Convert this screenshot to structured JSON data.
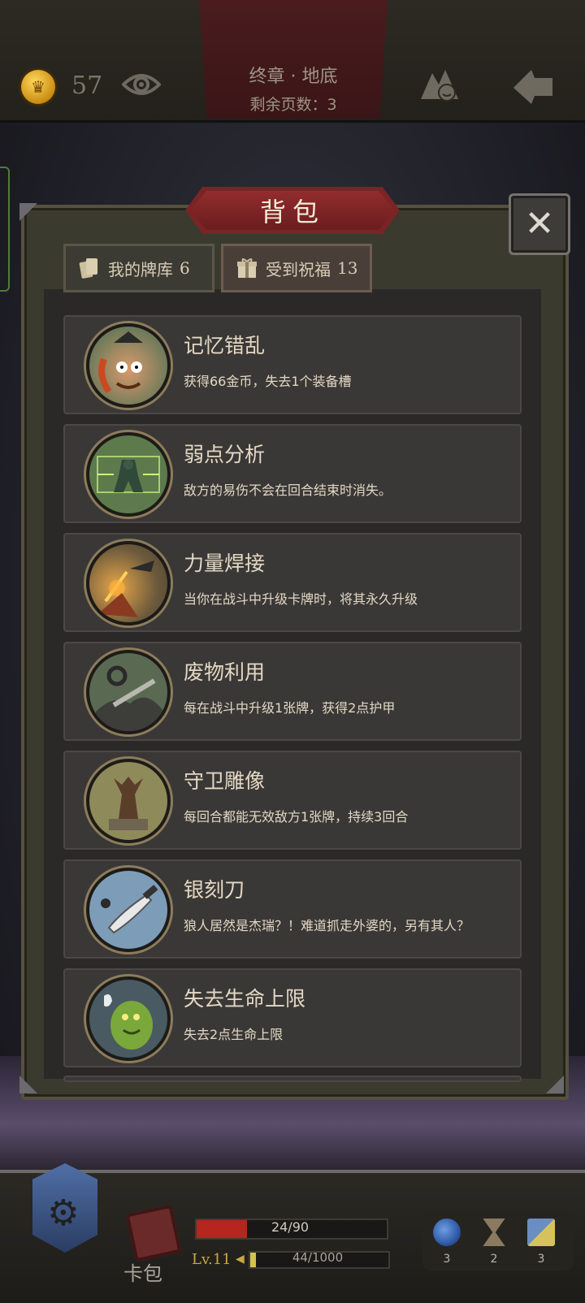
{
  "header": {
    "gold": "57",
    "chapter": "终章 · 地底",
    "pages_left": "剩余页数：3"
  },
  "panel": {
    "title": "背包",
    "tabs": [
      {
        "label": "我的牌库",
        "count": "6",
        "active": false
      },
      {
        "label": "受到祝福",
        "count": "13",
        "active": true
      }
    ],
    "items": [
      {
        "title": "记忆错乱",
        "desc": "获得66金币，失去1个装备槽",
        "icon": "pirate-portrait-icon"
      },
      {
        "title": "弱点分析",
        "desc": "敌方的易伤不会在回合结束时消失。",
        "icon": "scan-golem-icon"
      },
      {
        "title": "力量焊接",
        "desc": "当你在战斗中升级卡牌时，将其永久升级",
        "icon": "welding-sparks-icon"
      },
      {
        "title": "废物利用",
        "desc": "每在战斗中升级1张牌，获得2点护甲",
        "icon": "scrap-pile-icon"
      },
      {
        "title": "守卫雕像",
        "desc": "每回合都能无效敌方1张牌，持续3回合",
        "icon": "guardian-statue-icon"
      },
      {
        "title": "银刻刀",
        "desc": "狼人居然是杰瑞？！难道抓走外婆的，另有其人？",
        "icon": "silver-knife-icon"
      },
      {
        "title": "失去生命上限",
        "desc": "失去2点生命上限",
        "icon": "green-ogre-icon"
      }
    ]
  },
  "footer": {
    "bag_label": "卡包",
    "hp_text": "24/90",
    "hp_fraction": 0.267,
    "level": "Lv.11",
    "xp_text": "44/1000",
    "xp_fraction": 0.044,
    "resources": [
      {
        "icon": "potion-icon",
        "count": "3",
        "color": "#2f5aa8"
      },
      {
        "icon": "hourglass-icon",
        "count": "2",
        "color": "#8a7a60"
      },
      {
        "icon": "cards-icon",
        "count": "3",
        "color": "#6a8ec2"
      }
    ]
  }
}
